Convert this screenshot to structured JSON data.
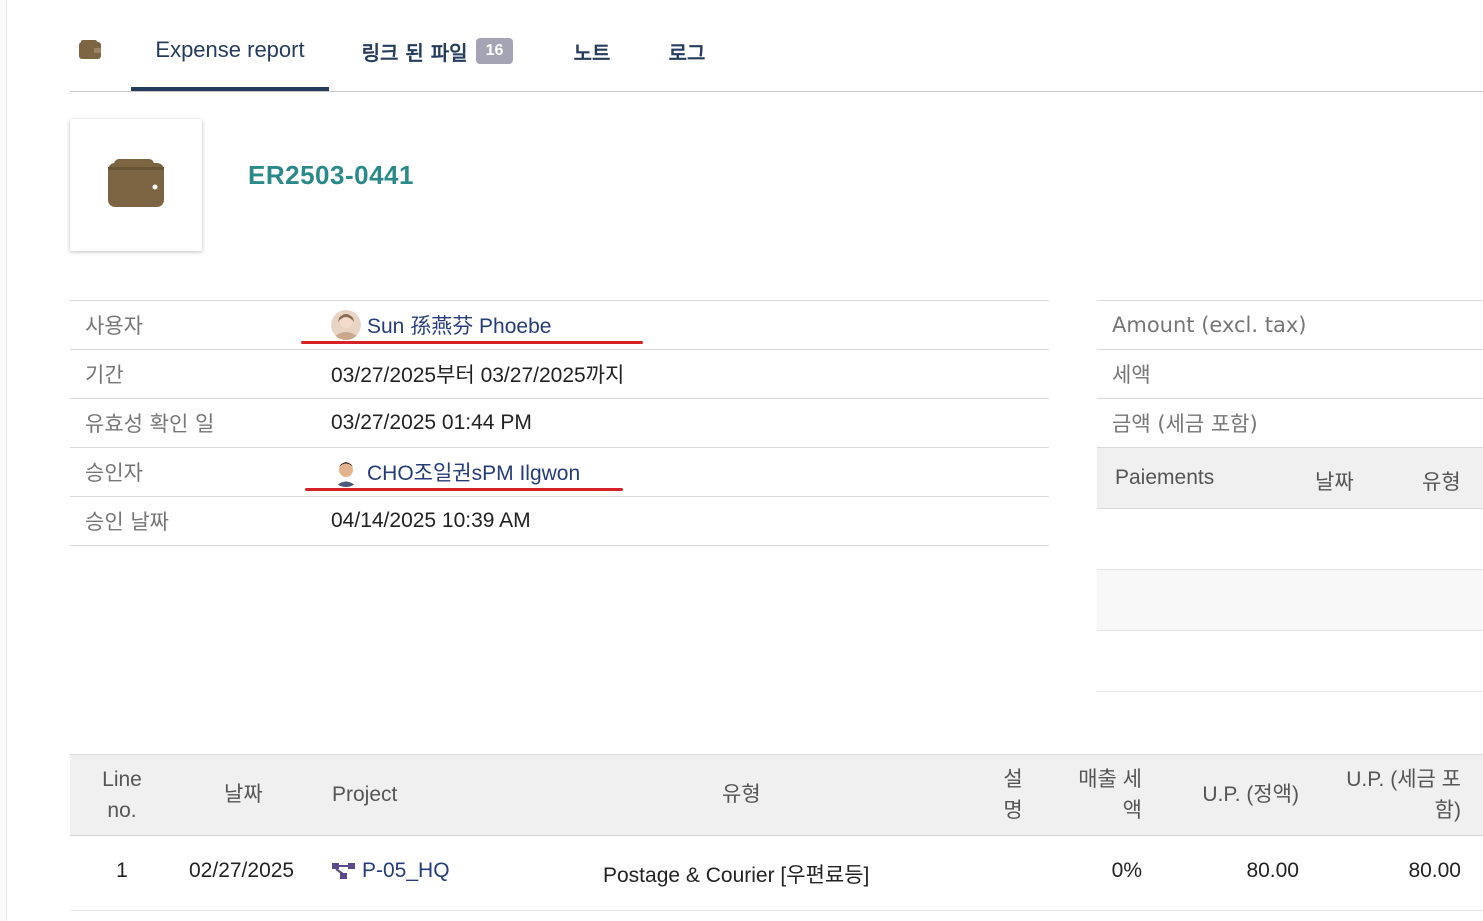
{
  "tabs": {
    "expense_report": "Expense report",
    "linked_files": "링크 된 파일",
    "linked_files_count": "16",
    "notes": "노트",
    "log": "로그"
  },
  "record": {
    "ref": "ER2503-0441"
  },
  "fields": [
    {
      "label": "사용자",
      "value": "Sun 孫燕芬 Phoebe"
    },
    {
      "label": "기간",
      "value": "03/27/2025부터 03/27/2025까지"
    },
    {
      "label": "유효성 확인 일",
      "value": "03/27/2025 01:44 PM"
    },
    {
      "label": "승인자",
      "value": "CHO조일권sPM Ilgwon"
    },
    {
      "label": "승인 날짜",
      "value": "04/14/2025 10:39 AM"
    }
  ],
  "summary": {
    "amount_excl_tax": "Amount (excl. tax)",
    "tax": "세액",
    "amount_incl_tax": "금액 (세금 포함)",
    "payments_header": {
      "col1": "Paiements",
      "col2": "날짜",
      "col3": "유형"
    }
  },
  "lines": {
    "headers": {
      "line_no_1": "Line",
      "line_no_2": "no.",
      "date": "날짜",
      "project": "Project",
      "type": "유형",
      "desc_1": "설",
      "desc_2": "명",
      "tax_1": "매출 세",
      "tax_2": "액",
      "up_net": "U.P. (정액)",
      "up_tax_1": "U.P. (세금 포",
      "up_tax_2": "함)"
    },
    "rows": [
      {
        "no": "1",
        "date": "02/27/2025",
        "project": "P-05_HQ",
        "type": "Postage & Courier [우편료등]",
        "tax": "0%",
        "up_net": "80.00",
        "up_tax": "80.00"
      }
    ]
  },
  "colors": {
    "accent_navy": "#263c5c",
    "ref_teal": "#2a8a8a",
    "wallet_brown": "#7d6543",
    "annotation_red": "#d8222a"
  }
}
